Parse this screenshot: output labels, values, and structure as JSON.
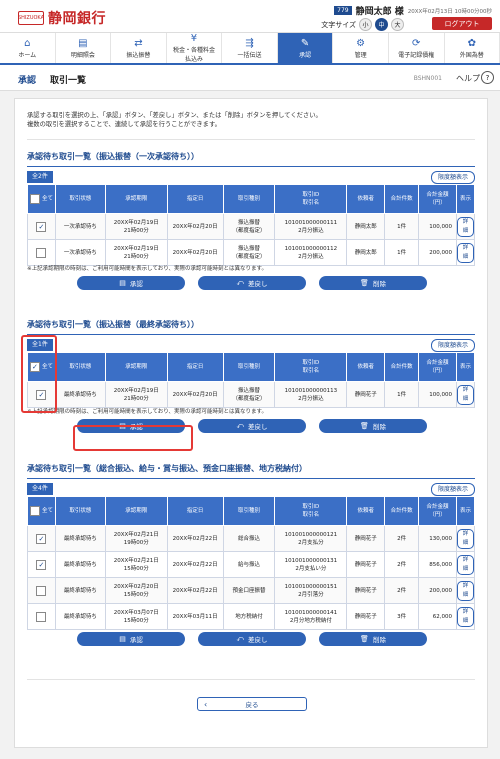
{
  "header": {
    "bank_name": "静岡銀行",
    "logo_mark": "SHIZUOKA",
    "user_badge": "779",
    "user_name": "静岡太郎 様",
    "login_time": "20XX年02月13日 10時00分00秒",
    "font_size_label": "文字サイズ",
    "font_sizes": [
      "小",
      "中",
      "大"
    ],
    "logout": "ログアウト"
  },
  "nav": [
    {
      "icon": "home-icon",
      "glyph": "⌂",
      "label": "ホーム"
    },
    {
      "icon": "statement-icon",
      "glyph": "▤",
      "label": "明細照会"
    },
    {
      "icon": "transfer-icon",
      "glyph": "⇄",
      "label": "振込振替"
    },
    {
      "icon": "tax-payment-icon",
      "glyph": "¥",
      "label": "税金・各種料金\n払込み"
    },
    {
      "icon": "bulk-transfer-icon",
      "glyph": "⇶",
      "label": "一括伝送"
    },
    {
      "icon": "approval-icon",
      "glyph": "✎",
      "label": "承認"
    },
    {
      "icon": "admin-icon",
      "glyph": "⚙",
      "label": "管理"
    },
    {
      "icon": "e-record-icon",
      "glyph": "⟳",
      "label": "電子記録債権"
    },
    {
      "icon": "forex-icon",
      "glyph": "✿",
      "label": "外国為替"
    }
  ],
  "page": {
    "title_main": "承認",
    "title_sub": "取引一覧",
    "screen_code": "BSHN001",
    "help": "ヘルプ",
    "help_icon": "?",
    "intro_1": "承認する取引を選択の上、「承認」ボタン、「差戻し」ボタン、または「削除」ボタンを押してください。",
    "intro_2": "複数の取引を選択することで、連続して承認を行うことができます。"
  },
  "labels": {
    "all": "全て",
    "limit_btn": "限度額表示",
    "detail": "詳細",
    "approve": "承認",
    "reject": "差戻し",
    "delete": "削除",
    "note": "※上記承認期限の時刻は、ご利用可能時間を表示しており、実際の承認可能時刻とは異なります。",
    "back": "戻る"
  },
  "section1": {
    "title": "承認待ち取引一覧（振込振替（一次承認待ち））",
    "count": "全2件",
    "headers": [
      "全て",
      "取引状態",
      "承認期限",
      "指定日",
      "取引種別",
      "取引ID\n取引名",
      "依頼者",
      "合計件数",
      "合計金額\n（円）",
      "表示"
    ],
    "rows": [
      {
        "checked": true,
        "status": "一次承認待ち",
        "deadline": "20XX年02月19日\n21時00分",
        "date": "20XX年02月20日",
        "type": "振込振替\n（都度指定）",
        "id_name": "101001000000111\n2月分振込",
        "requester": "静岡太郎",
        "count": "1件",
        "amount": "100,000"
      },
      {
        "checked": false,
        "status": "一次承認待ち",
        "deadline": "20XX年02月19日\n21時00分",
        "date": "20XX年02月20日",
        "type": "振込振替\n（都度指定）",
        "id_name": "101001000000112\n2月分振込",
        "requester": "静岡太郎",
        "count": "1件",
        "amount": "200,000"
      }
    ]
  },
  "section2": {
    "title": "承認待ち取引一覧（振込振替（最終承認待ち））",
    "count": "全1件",
    "headers": [
      "全て",
      "取引状態",
      "承認期限",
      "指定日",
      "取引種別",
      "取引ID\n取引名",
      "依頼者",
      "合計件数",
      "合計金額\n（円）",
      "表示"
    ],
    "rows": [
      {
        "checked": true,
        "status": "最終承認待ち",
        "deadline": "20XX年02月19日\n21時00分",
        "date": "20XX年02月20日",
        "type": "振込振替\n（都度指定）",
        "id_name": "101001000000113\n2月分振込",
        "requester": "静岡花子",
        "count": "1件",
        "amount": "100,000"
      }
    ]
  },
  "section3": {
    "title": "承認待ち取引一覧（総合振込、給与・賞与振込、預金口座振替、地方税納付）",
    "count": "全4件",
    "headers": [
      "全て",
      "取引状態",
      "承認期限",
      "指定日",
      "取引種別",
      "取引ID\n取引名",
      "依頼者",
      "合計件数",
      "合計金額\n（円）",
      "表示"
    ],
    "rows": [
      {
        "checked": true,
        "status": "最終承認待ち",
        "deadline": "20XX年02月21日\n19時00分",
        "date": "20XX年02月22日",
        "type": "総合振込",
        "id_name": "101001000000121\n2月支払分",
        "requester": "静岡花子",
        "count": "2件",
        "amount": "130,000"
      },
      {
        "checked": true,
        "status": "最終承認待ち",
        "deadline": "20XX年02月21日\n15時00分",
        "date": "20XX年02月22日",
        "type": "給与振込",
        "id_name": "101001000000131\n2月支払い分",
        "requester": "静岡花子",
        "count": "2件",
        "amount": "856,000"
      },
      {
        "checked": false,
        "status": "最終承認待ち",
        "deadline": "20XX年02月20日\n15時00分",
        "date": "20XX年02月22日",
        "type": "預金口座振替",
        "id_name": "101001000000151\n2月引落分",
        "requester": "静岡花子",
        "count": "2件",
        "amount": "200,000"
      },
      {
        "checked": false,
        "status": "最終承認待ち",
        "deadline": "20XX年03月07日\n15時00分",
        "date": "20XX年03月11日",
        "type": "地方税納付",
        "id_name": "101001000000141\n2月分地方税納付",
        "requester": "静岡花子",
        "count": "3件",
        "amount": "62,000"
      }
    ]
  },
  "colors": {
    "primary": "#2f63b6",
    "accent_red": "#c62828",
    "highlight": "#e53935"
  }
}
